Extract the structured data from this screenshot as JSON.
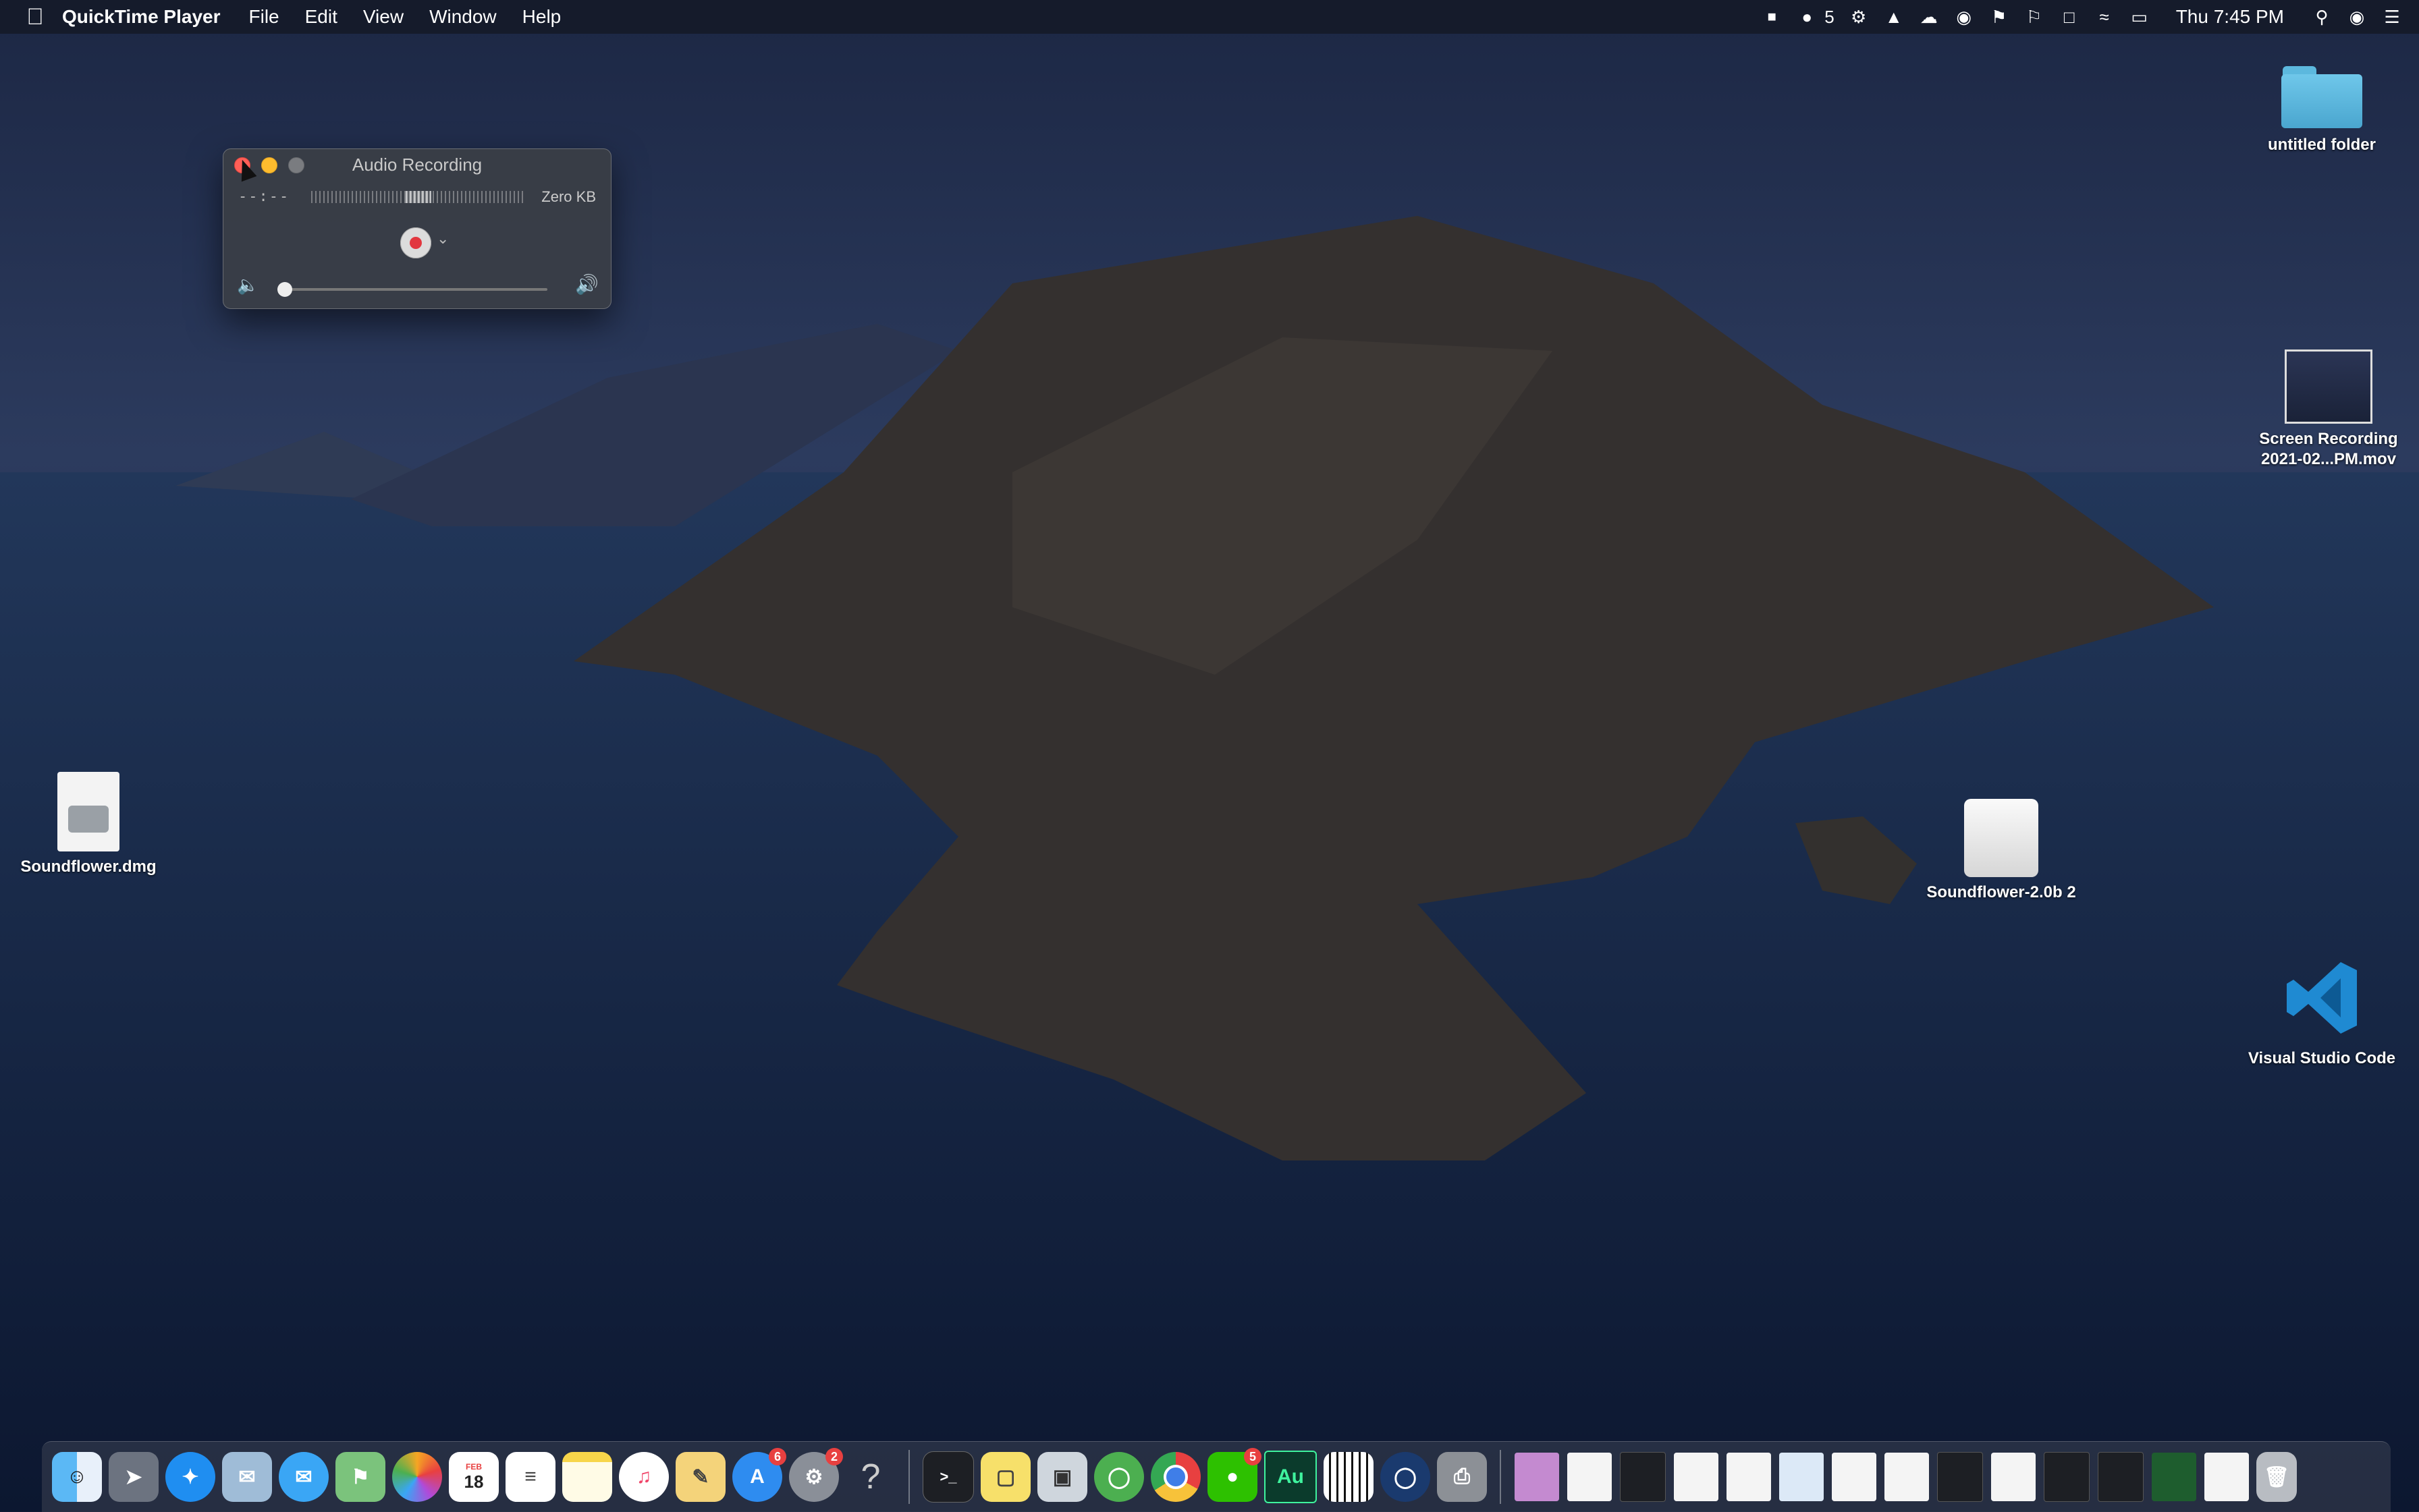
{
  "menubar": {
    "app_name": "QuickTime Player",
    "menus": [
      "File",
      "Edit",
      "View",
      "Window",
      "Help"
    ],
    "wechat_count": "5",
    "clock": "Thu 7:45 PM",
    "tray_icons": [
      "stop-recording-icon",
      "wechat-icon",
      "gear-icon",
      "adobe-icon",
      "creative-cloud-icon",
      "docker-icon",
      "flag-icon",
      "input-source-icon",
      "wifi-icon",
      "battery-icon",
      "spotlight-icon",
      "siri-icon",
      "control-center-icon"
    ]
  },
  "qt_window": {
    "title": "Audio Recording",
    "time": "--:--",
    "size": "Zero KB",
    "volume": 0.0
  },
  "desktop_icons": {
    "folder": "untitled folder",
    "screen_recording": "Screen Recording 2021-02...PM.mov",
    "dmg": "Soundflower.dmg",
    "soundflower_volume": "Soundflower-2.0b 2",
    "vscode": "Visual Studio Code"
  },
  "dock": {
    "calendar_month": "FEB",
    "calendar_day": "18",
    "appstore_badge": "6",
    "settings_badge": "2",
    "wechat_badge": "5",
    "audition_label": "Au",
    "help_label": "?"
  },
  "colors": {
    "accent": "#e2373f",
    "menubar": "#141826"
  }
}
